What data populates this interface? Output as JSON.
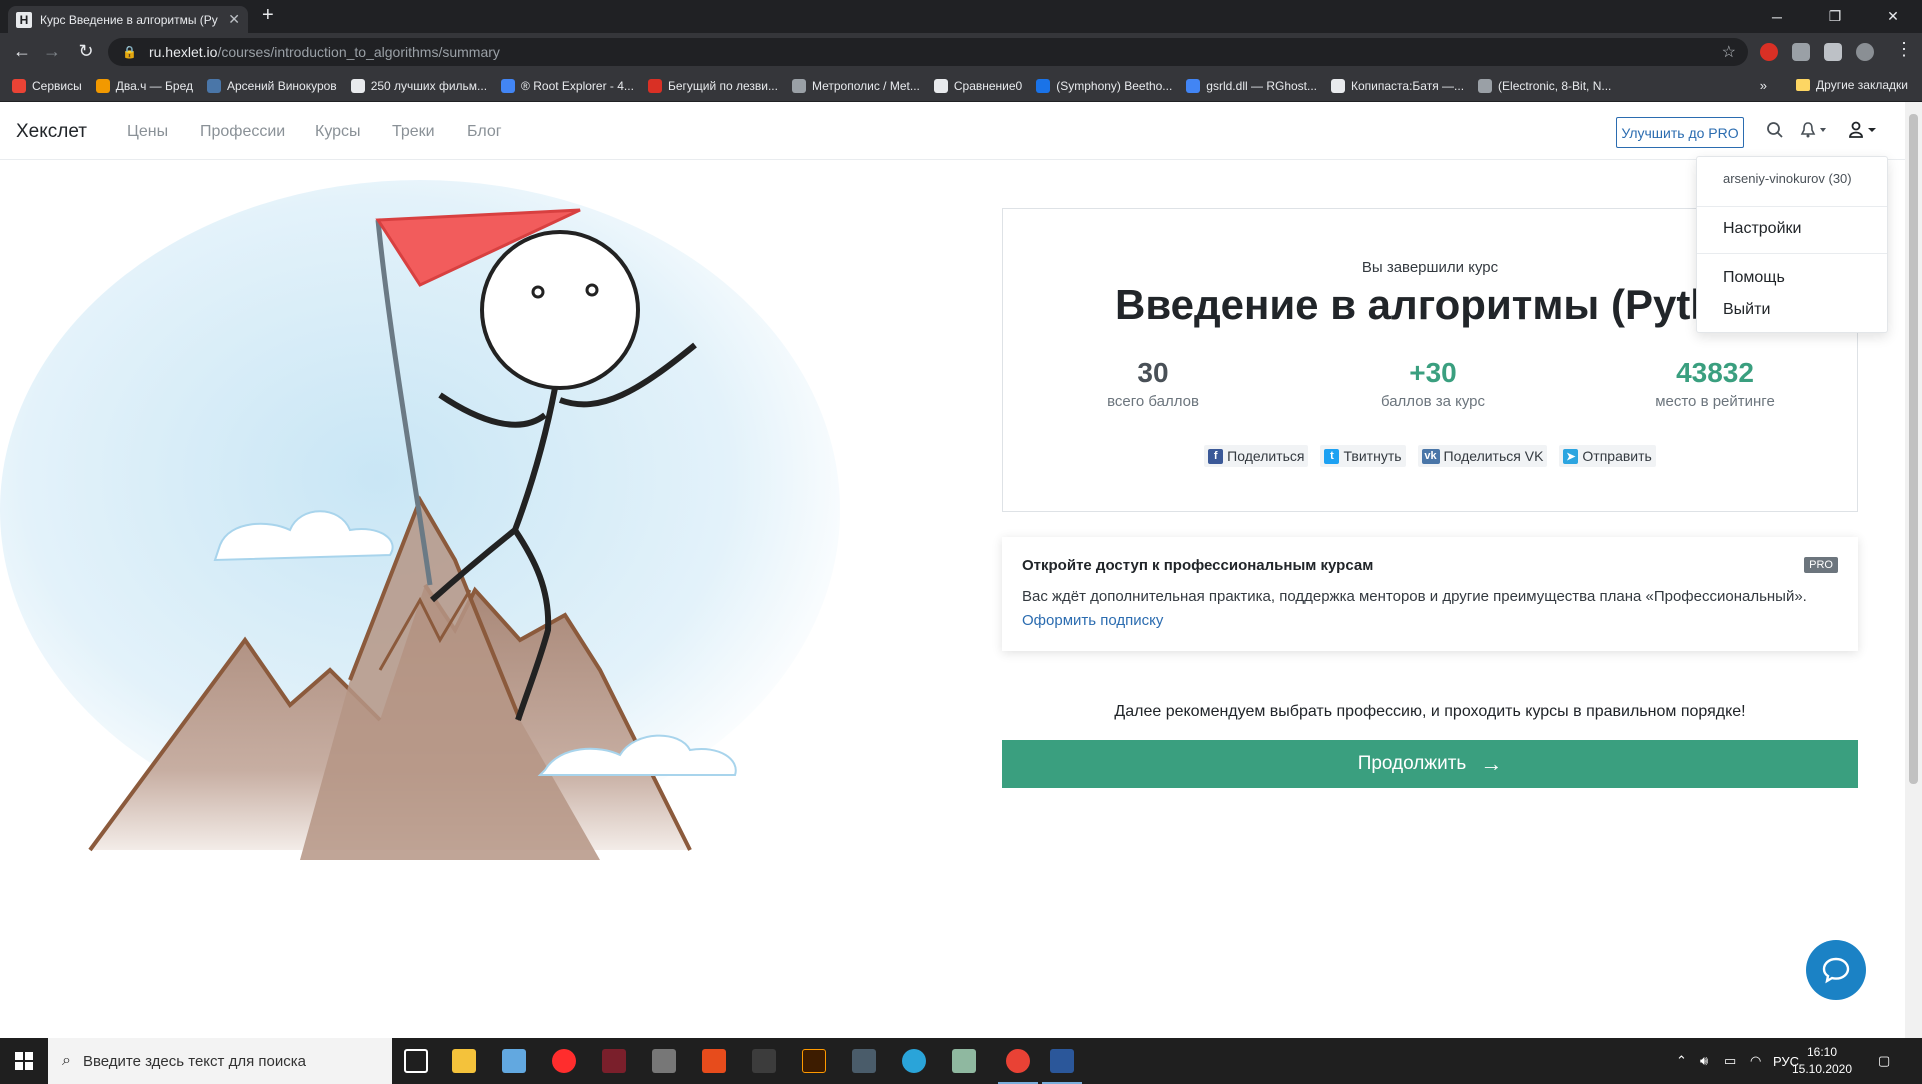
{
  "browser": {
    "tab_title": "Курс Введение в алгоритмы (Py",
    "tab_favicon": "Н",
    "url_host": "ru.hexlet.io",
    "url_path": "/courses/introduction_to_algorithms/summary",
    "bookmarks": [
      {
        "label": "Сервисы",
        "color": "#ea4335"
      },
      {
        "label": "Два.ч — Бред",
        "color": "#f29900"
      },
      {
        "label": "Арсений Винокуров",
        "color": "#4a76a8"
      },
      {
        "label": "250 лучших фильм...",
        "color": "#e8eaed"
      },
      {
        "label": "® Root Explorer - 4...",
        "color": "#4285f4"
      },
      {
        "label": "Бегущий по лезви...",
        "color": "#d93025"
      },
      {
        "label": "Метрополис / Met...",
        "color": "#9aa0a6"
      },
      {
        "label": "Сравнение0",
        "color": "#e8eaed"
      },
      {
        "label": "(Symphony) Beetho...",
        "color": "#1a73e8"
      },
      {
        "label": "gsrld.dll — RGhost...",
        "color": "#4285f4"
      },
      {
        "label": "Копипаста:Батя —...",
        "color": "#202124"
      },
      {
        "label": "(Electronic, 8-Bit, N...",
        "color": "#9aa0a6"
      }
    ],
    "bookmarks_more": "»",
    "other_bookmarks": "Другие закладки"
  },
  "site": {
    "logo": "Хекслет",
    "nav": [
      "Цены",
      "Профессии",
      "Курсы",
      "Треки",
      "Блог"
    ],
    "upgrade_button": "Улучшить до PRO"
  },
  "dropdown": {
    "user": "arseniy-vinokurov (30)",
    "settings": "Настройки",
    "help": "Помощь",
    "logout": "Выйти"
  },
  "summary": {
    "completed_label": "Вы завершили курс",
    "course_title": "Введение в алгоритмы (Python)",
    "stats": [
      {
        "value": "30",
        "label": "всего баллов",
        "color": "#495057"
      },
      {
        "value": "+30",
        "label": "баллов за курс",
        "color": "#3a9f7f"
      },
      {
        "value": "43832",
        "label": "место в рейтинге",
        "color": "#3a9f7f"
      }
    ],
    "share": {
      "facebook": "Поделиться",
      "twitter": "Твитнуть",
      "vk": "Поделиться VK",
      "telegram": "Отправить"
    }
  },
  "pro_card": {
    "title": "Откройте доступ к профессиональным курсам",
    "badge": "PRO",
    "text": "Вас ждёт дополнительная практика, поддержка менторов и другие преимущества плана «Профессиональный».",
    "link": "Оформить подписку"
  },
  "recommend_text": "Далее рекомендуем выбрать профессию, и проходить курсы в правильном порядке!",
  "continue_button": "Продолжить",
  "taskbar": {
    "search_placeholder": "Введите здесь текст для поиска",
    "lang": "РУС",
    "time": "16:10",
    "date": "15.10.2020"
  },
  "colors": {
    "accent_green": "#3a9f7f",
    "link_blue": "#2b6cb0",
    "chat_blue": "#1b82c5"
  }
}
